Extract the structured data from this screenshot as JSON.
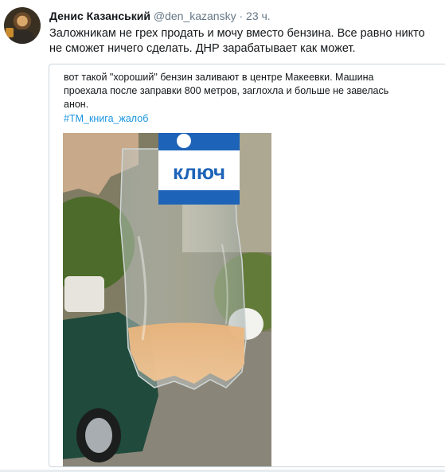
{
  "tweet": {
    "author_name": "Денис Казанський",
    "author_handle": "@den_kazansky",
    "separator": "·",
    "time": "23 ч.",
    "text": "Заложникам не грех продать и мочу вместо бензина. Все равно никто не сможет ничего сделать. ДНР зарабатывает как может."
  },
  "quoted": {
    "text": "вот такой \"хороший\" бензин заливают в центре Макеевки. Машина проехала после заправки 800 метров, заглохла и больше не завелась",
    "signature": "анон.",
    "hashtag": "#ТМ_книга_жалоб",
    "photo": {
      "label_text": "ключ",
      "label_color": "#1d63b8"
    }
  }
}
